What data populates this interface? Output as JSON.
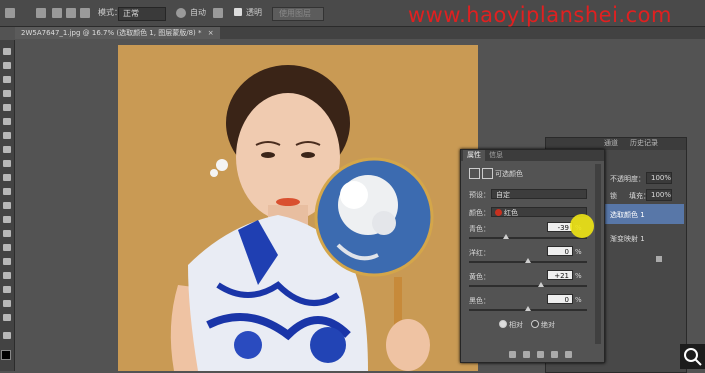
{
  "options_bar": {
    "mode_label": "模式：",
    "mode_value": "正常",
    "check_all_layers": "自动",
    "transparent_label": "透明",
    "disabled_button": "使用图层",
    "watermark": "www.haoyiplanshei.com"
  },
  "document_tab": {
    "title": "2W5A7647_1.jpg @ 16.7% (选取颜色 1, 图层蒙版/8) *",
    "close": "×"
  },
  "layers_panel": {
    "tabs": [
      "通道",
      "历史记录"
    ],
    "opacity_label": "不透明度：",
    "opacity_value": "100%",
    "lock_label": "锁",
    "fill_label": "填充：",
    "fill_value": "100%",
    "layers": [
      {
        "name": "选取颜色 1",
        "selected": true
      },
      {
        "name": "渐变映射 1",
        "selected": false
      }
    ]
  },
  "properties_panel": {
    "tabs": [
      "属性",
      "信息"
    ],
    "adjustment_title": "可选颜色",
    "preset_label": "预设：",
    "preset_value": "自定",
    "colors_label": "颜色：",
    "colors_value": "红色",
    "sliders": [
      {
        "label": "青色：",
        "value": "-39",
        "level": -39
      },
      {
        "label": "洋红：",
        "value": "0",
        "level": 0
      },
      {
        "label": "黄色：",
        "value": "+21",
        "level": 21
      },
      {
        "label": "黑色：",
        "value": "0",
        "level": 0
      }
    ],
    "percent": "%",
    "method_relative": "相对",
    "method_absolute": "绝对"
  },
  "colors": {
    "canvas_bg": "#c99a54",
    "red_swatch": "#c7301f",
    "selected_layer": "#5877a8",
    "watermark": "#e02020"
  }
}
